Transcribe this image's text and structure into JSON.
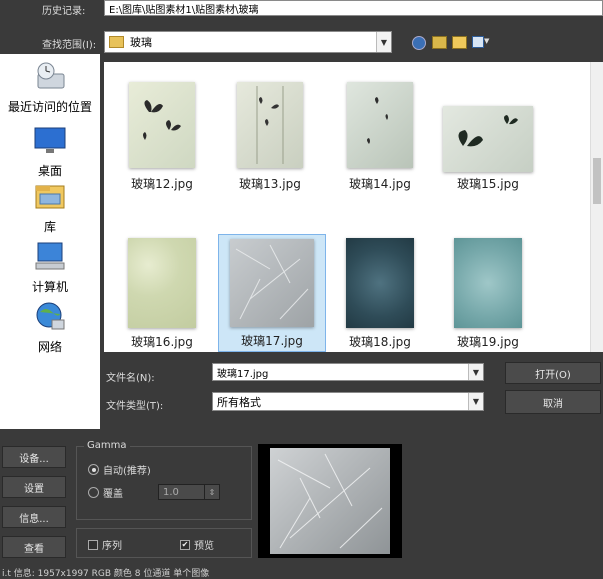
{
  "history": {
    "label": "历史记录:",
    "value": "E:\\图库\\贴图素材1\\贴图素材\\玻璃"
  },
  "lookin": {
    "label": "查找范围(I):",
    "value": "玻璃"
  },
  "sidebar": {
    "items": [
      {
        "label": "最近访问的位置",
        "icon": "recent-places-icon"
      },
      {
        "label": "桌面",
        "icon": "desktop-icon"
      },
      {
        "label": "库",
        "icon": "library-icon"
      },
      {
        "label": "计算机",
        "icon": "computer-icon"
      },
      {
        "label": "网络",
        "icon": "network-icon"
      }
    ]
  },
  "files": [
    {
      "name": "玻璃12.jpg",
      "thumb": "butterfly-glass",
      "selected": false
    },
    {
      "name": "玻璃13.jpg",
      "thumb": "butterfly-glass-light",
      "selected": false
    },
    {
      "name": "玻璃14.jpg",
      "thumb": "butterfly-glass-small",
      "selected": false
    },
    {
      "name": "玻璃15.jpg",
      "thumb": "butterfly-glass-dark",
      "selected": false
    },
    {
      "name": "玻璃16.jpg",
      "thumb": "dimpled-glass",
      "selected": false
    },
    {
      "name": "玻璃17.jpg",
      "thumb": "cracked-glass",
      "selected": true
    },
    {
      "name": "玻璃18.jpg",
      "thumb": "speckled-blue-glass",
      "selected": false
    },
    {
      "name": "玻璃19.jpg",
      "thumb": "frosted-teal-glass",
      "selected": false
    }
  ],
  "filename": {
    "label": "文件名(N):",
    "value": "玻璃17.jpg"
  },
  "filetype": {
    "label": "文件类型(T):",
    "value": "所有格式"
  },
  "buttons": {
    "open": "打开(O)",
    "cancel": "取消"
  },
  "side_buttons": [
    "设备...",
    "设置",
    "信息...",
    "查看"
  ],
  "gamma": {
    "title": "Gamma",
    "auto_label": "自动(推荐)",
    "override_label": "覆盖",
    "override_value": "1.0",
    "auto_selected": true
  },
  "sequence_label": "序列",
  "preview_label": "预览",
  "preview_checked": true,
  "sequence_checked": false,
  "info_text": "i.t 信息: 1957x1997 RGB 颜色 8 位通道 单个图像",
  "colors": {
    "bg": "#3a3a3a",
    "selected": "#cde6f7",
    "selected_border": "#7eb4ea"
  }
}
